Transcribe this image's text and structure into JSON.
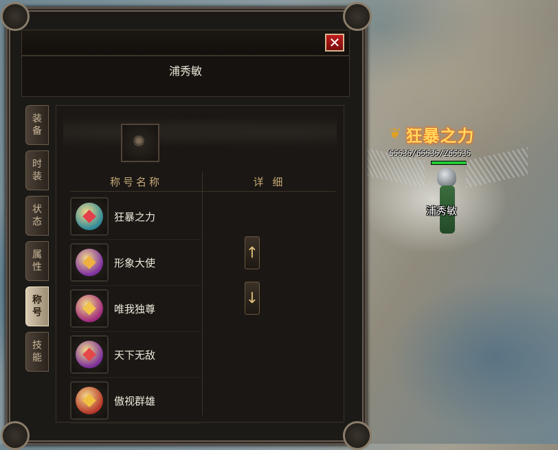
{
  "world": {
    "character": {
      "title": "狂暴之力",
      "stats": "65535/65535/Z65535",
      "hp_fraction": 1.0,
      "name": "浦秀敏"
    }
  },
  "panel": {
    "close_icon": "close-x",
    "player_name": "浦秀敏",
    "tabs": [
      {
        "label": "装备",
        "active": false
      },
      {
        "label": "时装",
        "active": false
      },
      {
        "label": "状态",
        "active": false
      },
      {
        "label": "属性",
        "active": false
      },
      {
        "label": "称号",
        "active": true
      },
      {
        "label": "技能",
        "active": false
      }
    ],
    "columns": {
      "name": "称号名称",
      "detail": "详 细"
    },
    "titles": [
      {
        "label": "狂暴之力",
        "color": "#2e8a98",
        "gem": "#e2404a"
      },
      {
        "label": "形象大使",
        "color": "#7d2fa0",
        "gem": "#f0b040"
      },
      {
        "label": "唯我独尊",
        "color": "#a02a7c",
        "gem": "#f2c24a"
      },
      {
        "label": "天下无敌",
        "color": "#7a2f9a",
        "gem": "#e44848"
      },
      {
        "label": "傲视群雄",
        "color": "#b5372a",
        "gem": "#f2c040"
      }
    ],
    "scroll_up_icon": "arrow-up",
    "scroll_down_icon": "arrow-down"
  }
}
